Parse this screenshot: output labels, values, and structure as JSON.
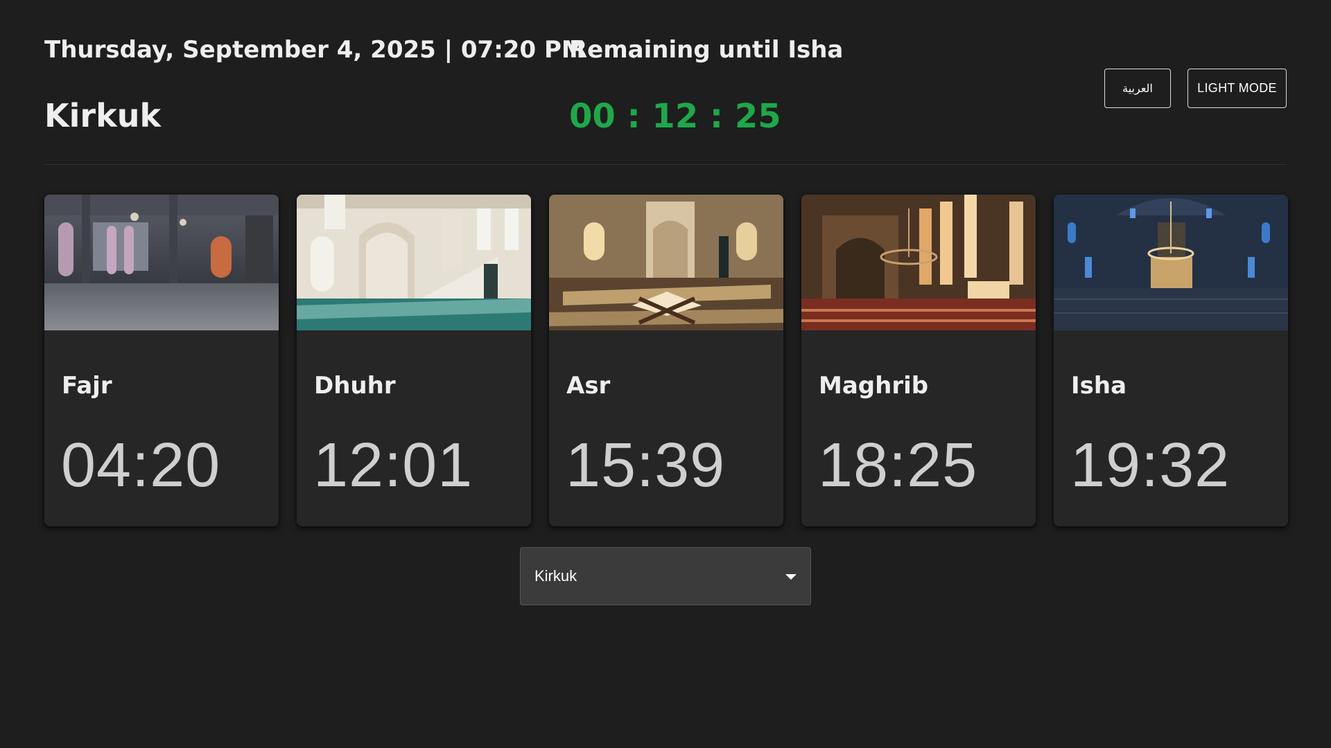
{
  "header": {
    "datetime": "Thursday, September 4, 2025 | 07:20 PM",
    "city": "Kirkuk",
    "remaining_label": "Remaining until Isha",
    "countdown": "00 : 12 : 25",
    "countdown_color": "#1ea84a",
    "language_button": "العربية",
    "mode_button": "LIGHT MODE"
  },
  "prayers": [
    {
      "name": "Fajr",
      "time": "04:20",
      "image_icon": "mosque-interior-dawn-image"
    },
    {
      "name": "Dhuhr",
      "time": "12:01",
      "image_icon": "mosque-interior-minbar-image"
    },
    {
      "name": "Asr",
      "time": "15:39",
      "image_icon": "mosque-interior-quran-image"
    },
    {
      "name": "Maghrib",
      "time": "18:25",
      "image_icon": "mosque-interior-chandelier-image"
    },
    {
      "name": "Isha",
      "time": "19:32",
      "image_icon": "mosque-interior-night-image"
    }
  ],
  "city_select": {
    "selected": "Kirkuk"
  },
  "colors": {
    "background": "#1e1e1e",
    "card": "#262626",
    "accent_green": "#1ea84a"
  }
}
